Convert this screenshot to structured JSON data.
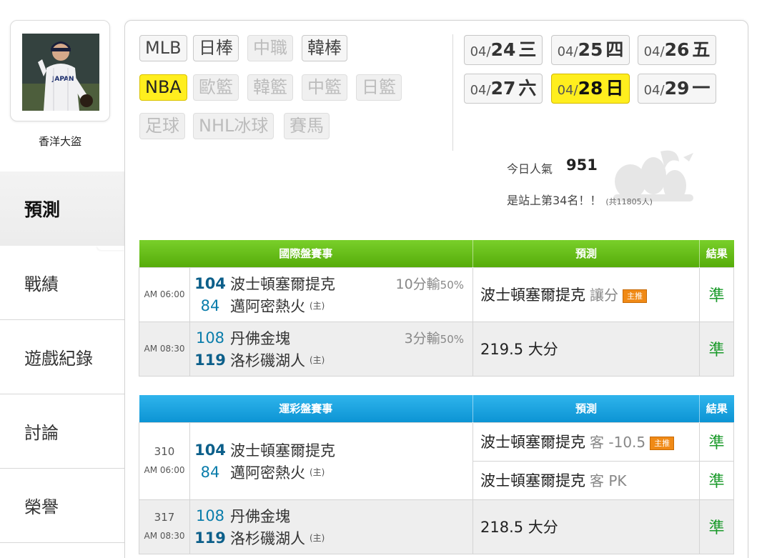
{
  "user": {
    "name": "香洋大盜"
  },
  "nav": [
    {
      "label": "預測",
      "active": true
    },
    {
      "label": "戰績",
      "active": false
    },
    {
      "label": "遊戲紀錄",
      "active": false
    },
    {
      "label": "討論",
      "active": false
    },
    {
      "label": "榮譽",
      "active": false
    }
  ],
  "sports": [
    {
      "label": "MLB",
      "state": "normal"
    },
    {
      "label": "日棒",
      "state": "normal"
    },
    {
      "label": "中職",
      "state": "disabled"
    },
    {
      "label": "韓棒",
      "state": "normal"
    },
    {
      "label": "NBA",
      "state": "selected"
    },
    {
      "label": "歐籃",
      "state": "disabled"
    },
    {
      "label": "韓籃",
      "state": "disabled"
    },
    {
      "label": "中籃",
      "state": "disabled"
    },
    {
      "label": "日籃",
      "state": "disabled"
    },
    {
      "label": "足球",
      "state": "disabled"
    },
    {
      "label": "NHL冰球",
      "state": "disabled"
    },
    {
      "label": "賽馬",
      "state": "disabled"
    }
  ],
  "dates": [
    {
      "md": "04/",
      "d": "24",
      "wd": "三",
      "selected": false
    },
    {
      "md": "04/",
      "d": "25",
      "wd": "四",
      "selected": false
    },
    {
      "md": "04/",
      "d": "26",
      "wd": "五",
      "selected": false
    },
    {
      "md": "04/",
      "d": "27",
      "wd": "六",
      "selected": false
    },
    {
      "md": "04/",
      "d": "28",
      "wd": "日",
      "selected": true
    },
    {
      "md": "04/",
      "d": "29",
      "wd": "一",
      "selected": false
    }
  ],
  "stats": {
    "popularity_label": "今日人氣",
    "popularity_value": "951",
    "rank_text": "是站上第34名！！",
    "rank_total": "(共11805人)"
  },
  "intl_table": {
    "headers": [
      "國際盤賽事",
      "預測",
      "結果"
    ],
    "rows": [
      {
        "time": "AM 06:00",
        "away_score": "104",
        "away_team": "波士頓塞爾提克",
        "home_score": "84",
        "home_team": "邁阿密熱火",
        "home_tag": "(主)",
        "line": "10分輸",
        "line_pct": "50%",
        "pred_team": "波士頓塞爾提克",
        "pred_sub": "讓分",
        "badge": "主推",
        "result": "準"
      },
      {
        "time": "AM 08:30",
        "away_score": "108",
        "away_team": "丹佛金塊",
        "home_score": "119",
        "home_team": "洛杉磯湖人",
        "home_tag": "(主)",
        "line": "3分輸",
        "line_pct": "50%",
        "pred_text": "219.5 大分",
        "result": "準"
      }
    ]
  },
  "sport_table": {
    "headers": [
      "運彩盤賽事",
      "預測",
      "結果"
    ],
    "rows": [
      {
        "num": "310",
        "time": "AM 06:00",
        "away_score": "104",
        "away_team": "波士頓塞爾提克",
        "home_score": "84",
        "home_team": "邁阿密熱火",
        "home_tag": "(主)",
        "pred1_team": "波士頓塞爾提克",
        "pred1_sub": "客 -10.5",
        "badge": "主推",
        "result1": "準",
        "pred2_team": "波士頓塞爾提克",
        "pred2_sub": "客 PK",
        "result2": "準"
      },
      {
        "num": "317",
        "time": "AM 08:30",
        "away_score": "108",
        "away_team": "丹佛金塊",
        "home_score": "119",
        "home_team": "洛杉磯湖人",
        "home_tag": "(主)",
        "pred_text": "218.5 大分",
        "result": "準"
      }
    ]
  }
}
